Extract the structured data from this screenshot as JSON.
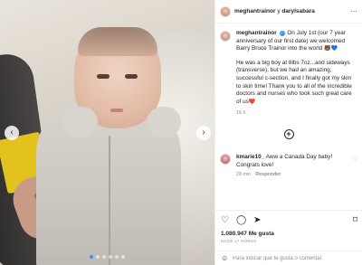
{
  "header": {
    "user1": "meghantrainor",
    "separator": " y ",
    "user2": "darylsabara",
    "more_glyph": "···"
  },
  "post": {
    "author": "meghantrainor",
    "caption_p1": "On July 1st (our 7 year anniversary of our first date) we welcomed Barry Bruce Trainor into the world",
    "caption_p1_emoji": "🐻💙",
    "caption_p2": "He was a big boy at 8lbs 7oz...and sideways (transverse), but we had an amazing, successful c-section, and I finally got my skin to skin time! Thank you to all of the incredible doctors and nurses who took such great care of us",
    "caption_p2_emoji": "❤️",
    "time_ago": "16 h"
  },
  "comment": {
    "author": "kmarie10_",
    "text": "Aww a Canada Day baby! Congrats love!",
    "time_ago": "28 min",
    "reply_label": "Responder"
  },
  "actions": {
    "likes": "1.080.947 Me gusta",
    "date": "HACE 17 HORAS"
  },
  "add_comment": {
    "placeholder": "Para indicar que te gusta o comentar."
  },
  "media": {
    "prev_glyph": "‹",
    "next_glyph": "›",
    "slide_count": 6,
    "active_slide": 1
  },
  "icons": {
    "verified": "verified-badge-icon",
    "heart": "heart-icon",
    "comment": "comment-icon",
    "share": "share-icon",
    "bookmark": "bookmark-icon",
    "plus": "plus-circle-icon",
    "more": "more-icon",
    "smile": "smile-icon"
  },
  "colors": {
    "accent": "#3897f0",
    "text": "#262626",
    "muted": "#8e8e8e",
    "border": "#efefef"
  }
}
